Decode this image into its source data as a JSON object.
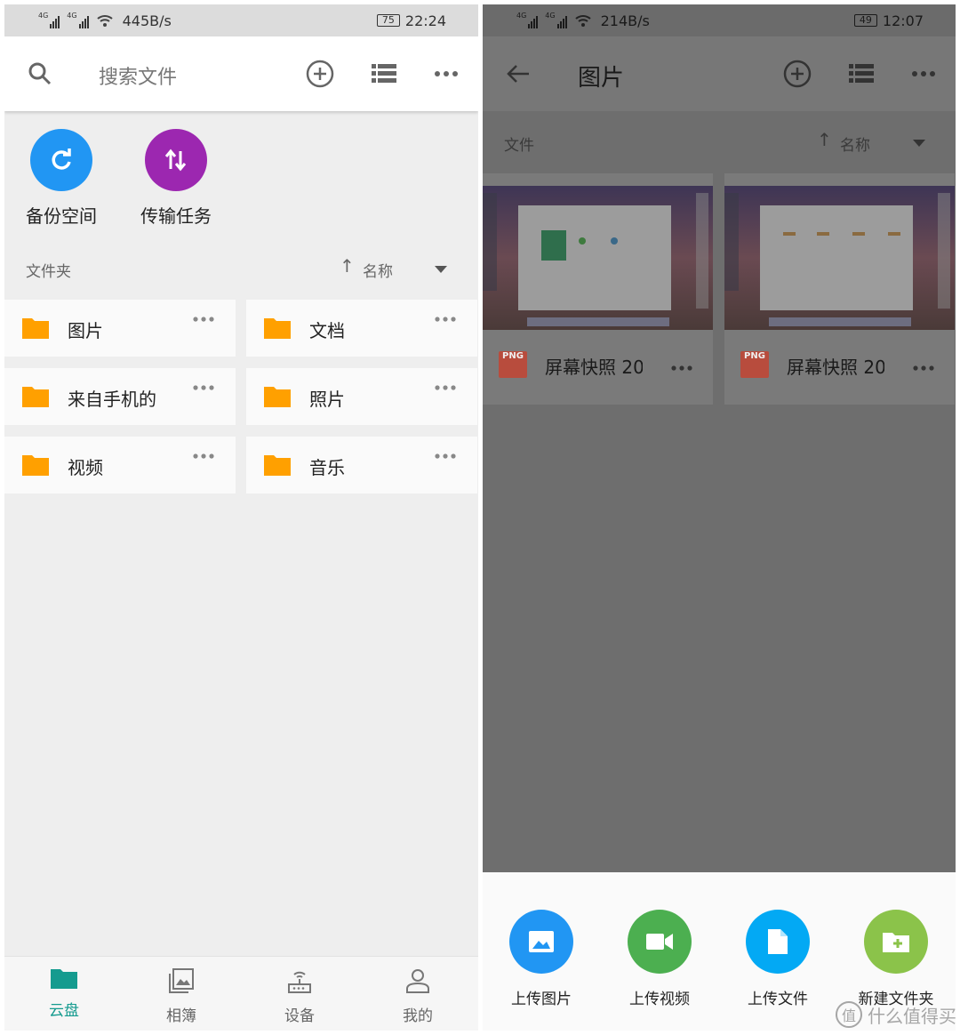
{
  "left": {
    "status": {
      "signal_tag": "4G",
      "speed": "445B/s",
      "battery": "75",
      "time": "22:24"
    },
    "search": {
      "placeholder": "搜索文件"
    },
    "quick_actions": [
      {
        "label": "备份空间",
        "icon": "refresh-icon",
        "color": "#2196f3"
      },
      {
        "label": "传输任务",
        "icon": "transfer-icon",
        "color": "#9c27b0"
      }
    ],
    "section": {
      "title": "文件夹",
      "sort_label": "名称"
    },
    "folders": [
      {
        "name": "图片"
      },
      {
        "name": "文档"
      },
      {
        "name": "来自手机的"
      },
      {
        "name": "照片"
      },
      {
        "name": "视频"
      },
      {
        "name": "音乐"
      }
    ],
    "bottom_nav": [
      {
        "label": "云盘",
        "icon": "cloud-folder-icon",
        "active": true
      },
      {
        "label": "相簿",
        "icon": "album-icon",
        "active": false
      },
      {
        "label": "设备",
        "icon": "router-icon",
        "active": false
      },
      {
        "label": "我的",
        "icon": "person-icon",
        "active": false
      }
    ],
    "colors": {
      "accent": "#159b8f",
      "folder": "#ffa000"
    }
  },
  "right": {
    "status": {
      "signal_tag": "4G",
      "speed": "214B/s",
      "battery": "49",
      "time": "12:07"
    },
    "header": {
      "title": "图片"
    },
    "section": {
      "title": "文件",
      "sort_label": "名称"
    },
    "files": [
      {
        "badge": "PNG",
        "name": "屏幕快照 20"
      },
      {
        "badge": "PNG",
        "name": "屏幕快照 20"
      }
    ],
    "actions": [
      {
        "label": "上传图片",
        "icon": "image-icon",
        "color": "#2196f3"
      },
      {
        "label": "上传视频",
        "icon": "video-icon",
        "color": "#4caf50"
      },
      {
        "label": "上传文件",
        "icon": "file-icon",
        "color": "#03a9f4"
      },
      {
        "label": "新建文件夹",
        "icon": "new-folder-icon",
        "color": "#8bc34a"
      }
    ]
  },
  "watermark": {
    "text": "什么值得买",
    "badge": "值"
  }
}
